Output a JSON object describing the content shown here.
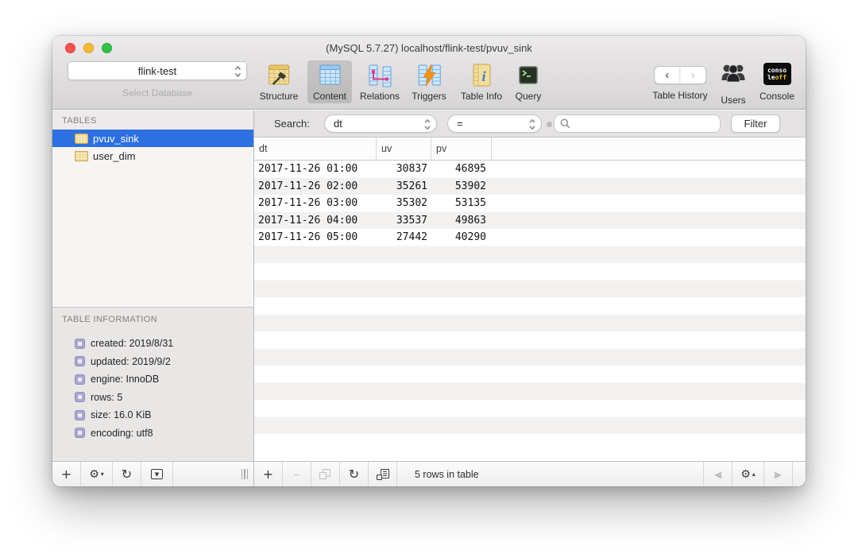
{
  "window": {
    "title": "(MySQL 5.7.27) localhost/flink-test/pvuv_sink"
  },
  "toolbar": {
    "database_selector": {
      "value": "flink-test",
      "label": "Select Database"
    },
    "items": [
      {
        "label": "Structure",
        "icon": "structure-table-icon"
      },
      {
        "label": "Content",
        "icon": "content-table-icon",
        "active": true
      },
      {
        "label": "Relations",
        "icon": "relations-icon"
      },
      {
        "label": "Triggers",
        "icon": "triggers-icon"
      },
      {
        "label": "Table Info",
        "icon": "table-info-icon"
      },
      {
        "label": "Query",
        "icon": "query-terminal-icon"
      }
    ],
    "table_history": {
      "label": "Table History",
      "back_glyph": "‹",
      "forward_glyph": "›"
    },
    "users": {
      "label": "Users",
      "icon": "users-icon"
    },
    "console": {
      "label": "Console",
      "badge_line1": "conso",
      "badge_line2a": "le",
      "badge_line2b": "off"
    }
  },
  "sidebar": {
    "tables_header": "TABLES",
    "tables": [
      {
        "name": "pvuv_sink",
        "selected": true
      },
      {
        "name": "user_dim",
        "selected": false
      }
    ],
    "info_header": "TABLE INFORMATION",
    "info_items": [
      "created: 2019/8/31",
      "updated: 2019/9/2",
      "engine: InnoDB",
      "rows: 5",
      "size: 16.0 KiB",
      "encoding: utf8"
    ]
  },
  "filter_bar": {
    "search_label": "Search:",
    "field_value": "dt",
    "operator_value": "=",
    "search_value": "",
    "filter_button": "Filter"
  },
  "table": {
    "columns": [
      "dt",
      "uv",
      "pv"
    ],
    "rows": [
      [
        "2017-11-26 01:00",
        "30837",
        "46895"
      ],
      [
        "2017-11-26 02:00",
        "35261",
        "53902"
      ],
      [
        "2017-11-26 03:00",
        "35302",
        "53135"
      ],
      [
        "2017-11-26 04:00",
        "33537",
        "49863"
      ],
      [
        "2017-11-26 05:00",
        "27442",
        "40290"
      ]
    ]
  },
  "footer": {
    "status": "5 rows in table",
    "glyphs": {
      "add": "+",
      "remove": "–",
      "refresh": "↻",
      "gear": "⚙",
      "caret_down": "▾",
      "caret_up": "▴",
      "prev": "◀",
      "next": "▶",
      "popdown": "▼"
    }
  },
  "colors": {
    "selection_blue": "#2C70E2",
    "stripe_gray": "#F3F1F0",
    "chrome_gray": "#E4E2E3",
    "console_badge_accent": "#F2C10E"
  }
}
